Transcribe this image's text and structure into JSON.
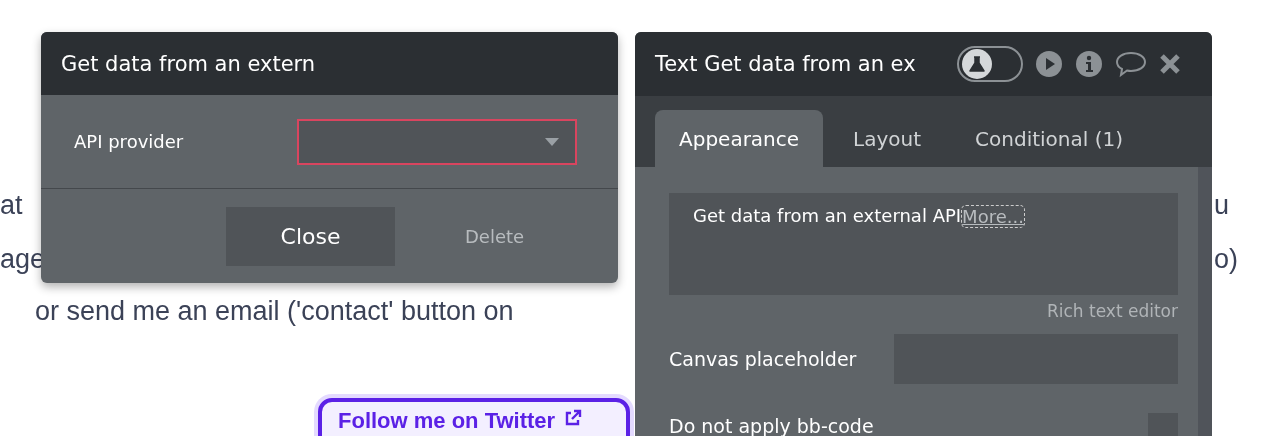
{
  "background_page": {
    "fragments": [
      "at",
      "u",
      "age",
      "o)",
      "or send me an email ('contact' button on"
    ],
    "twitter_button": "Follow me on Twitter"
  },
  "data_dialog": {
    "title": "Get data from an extern",
    "field_label": "API provider",
    "field_invalid": true,
    "buttons": [
      {
        "label": "Close",
        "kind": "primary"
      },
      {
        "label": "Delete",
        "kind": "plain"
      }
    ]
  },
  "property_editor": {
    "title": "Text Get data from an ex",
    "test_mode": {
      "on": false
    },
    "tabs": [
      {
        "label": "Appearance",
        "selected": true
      },
      {
        "label": "Layout",
        "selected": false
      },
      {
        "label": "Conditional (1)",
        "selected": false
      }
    ],
    "content": "Get data from an external API",
    "more_link": "More...",
    "rich_text_link": "Rich text editor",
    "rows": [
      {
        "label": "Canvas placeholder",
        "kind": "input"
      },
      {
        "label": "Do not apply bb-code",
        "kind": "checkbox",
        "checked": false
      }
    ]
  }
}
